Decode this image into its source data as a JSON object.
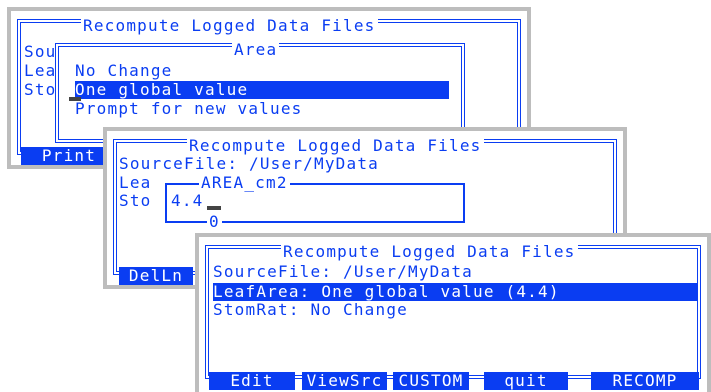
{
  "window1": {
    "title": "Recompute Logged Data Files",
    "labels": [
      "Sou",
      "Lea",
      "Sto"
    ],
    "popup_title": "Area",
    "options": [
      "No Change",
      "One global value",
      "Prompt for new values"
    ],
    "selected_index": 1,
    "fkey": "Print"
  },
  "window2": {
    "title": "Recompute Logged Data Files",
    "source_line": "SourceFile: /User/MyData",
    "labels": [
      "Lea",
      "Sto"
    ],
    "popup_title": "AREA_cm2",
    "input_value": "4.4",
    "popup_bottom": "0",
    "fkey": "DelLn"
  },
  "window3": {
    "title": "Recompute Logged Data Files",
    "lines": [
      "SourceFile: /User/MyData",
      "LeafArea: One global value (4.4)",
      "StomRat: No Change"
    ],
    "selected_line": 1,
    "fkeys": [
      "Edit",
      "ViewSrc",
      "CUSTOM",
      "quit",
      "RECOMP"
    ]
  },
  "colors": {
    "text": "#0a3df2",
    "window_frame": "#bdbdbd",
    "background": "#ffffff"
  }
}
